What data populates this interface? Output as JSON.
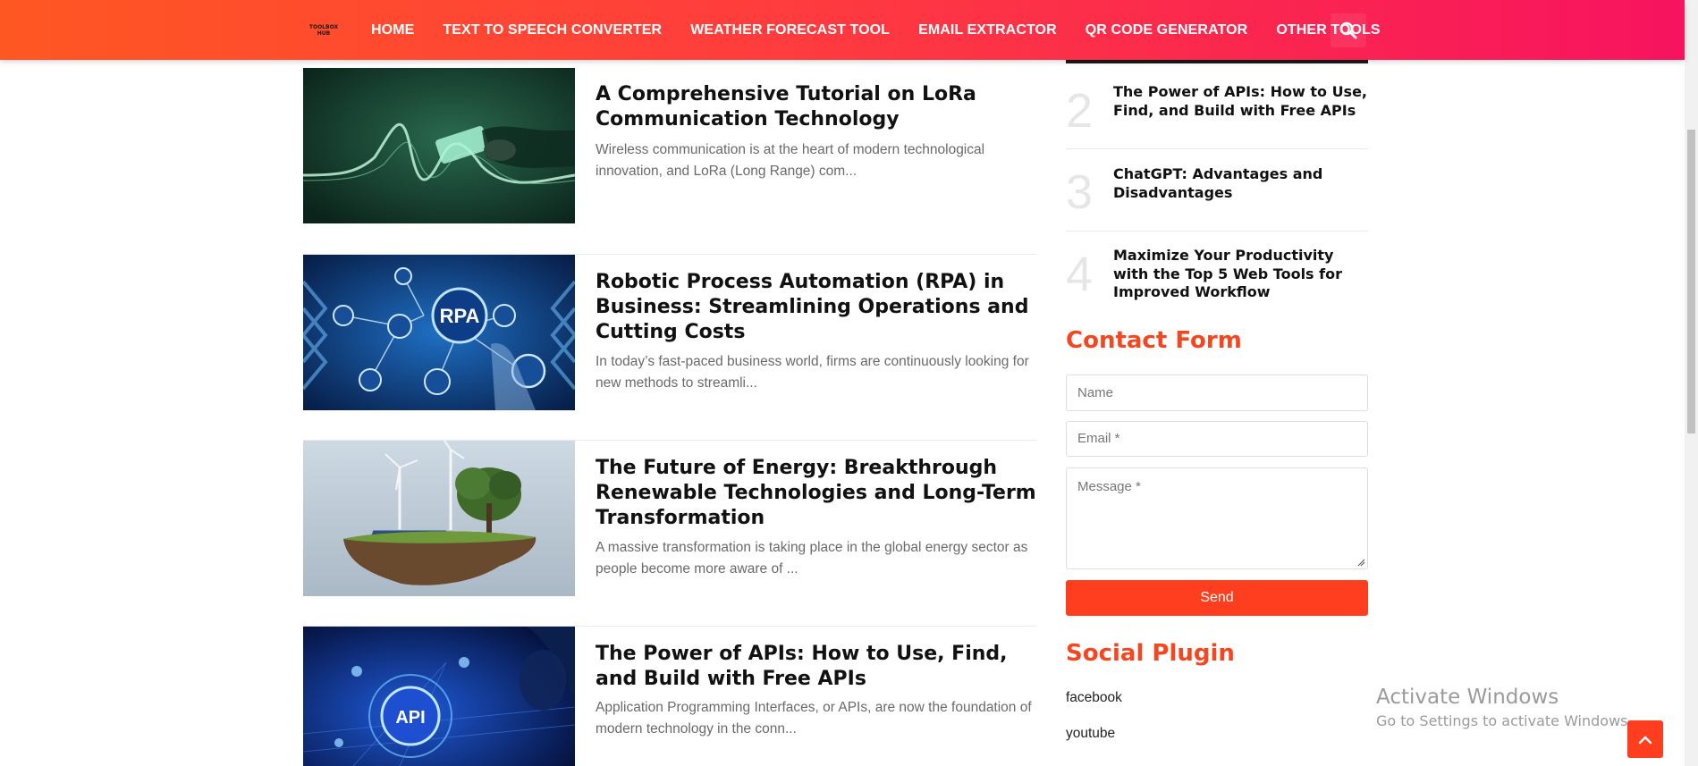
{
  "header": {
    "logo_text": "TOOLBOX HUB",
    "nav": [
      "HOME",
      "TEXT TO SPEECH CONVERTER",
      "WEATHER FORECAST TOOL",
      "EMAIL EXTRACTOR",
      "QR CODE GENERATOR",
      "OTHER TOOLS"
    ],
    "search_icon": "search-icon"
  },
  "posts": [
    {
      "title": "A Comprehensive Tutorial on LoRa Communication Technology",
      "excerpt": "Wireless communication is at the heart of modern technological innovation, and LoRa (Long Range) com..."
    },
    {
      "title": "Robotic Process Automation (RPA) in Business: Streamlining Operations and Cutting Costs",
      "excerpt": "In today’s fast-paced business world, firms are continuously looking for new methods to streamli...",
      "image_label": "RPA"
    },
    {
      "title": "The Future of Energy: Breakthrough Renewable Technologies and Long-Term Transformation",
      "excerpt": "A massive transformation is taking place in the global energy sector as people become more aware of ..."
    },
    {
      "title": "The Power of APIs: How to Use, Find, and Build with Free APIs",
      "excerpt": "Application Programming Interfaces, or APIs, are now the foundation of modern technology in the conn...",
      "image_label": "API"
    }
  ],
  "popular": [
    {
      "num": "2",
      "title": "The Power of APIs: How to Use, Find, and Build with Free APIs"
    },
    {
      "num": "3",
      "title": "ChatGPT: Advantages and Disadvantages"
    },
    {
      "num": "4",
      "title": "Maximize Your Productivity with the Top 5 Web Tools for Improved Workflow"
    }
  ],
  "contact": {
    "heading": "Contact Form",
    "name_placeholder": "Name",
    "email_placeholder": "Email *",
    "message_placeholder": "Message *",
    "send_label": "Send"
  },
  "social": {
    "heading": "Social Plugin",
    "links": [
      "facebook",
      "youtube"
    ]
  },
  "watermark": {
    "line1": "Activate Windows",
    "line2": "Go to Settings to activate Windows."
  },
  "colors": {
    "accent": "#f4461f",
    "header_start": "#ff5722",
    "header_end": "#f7135f"
  }
}
